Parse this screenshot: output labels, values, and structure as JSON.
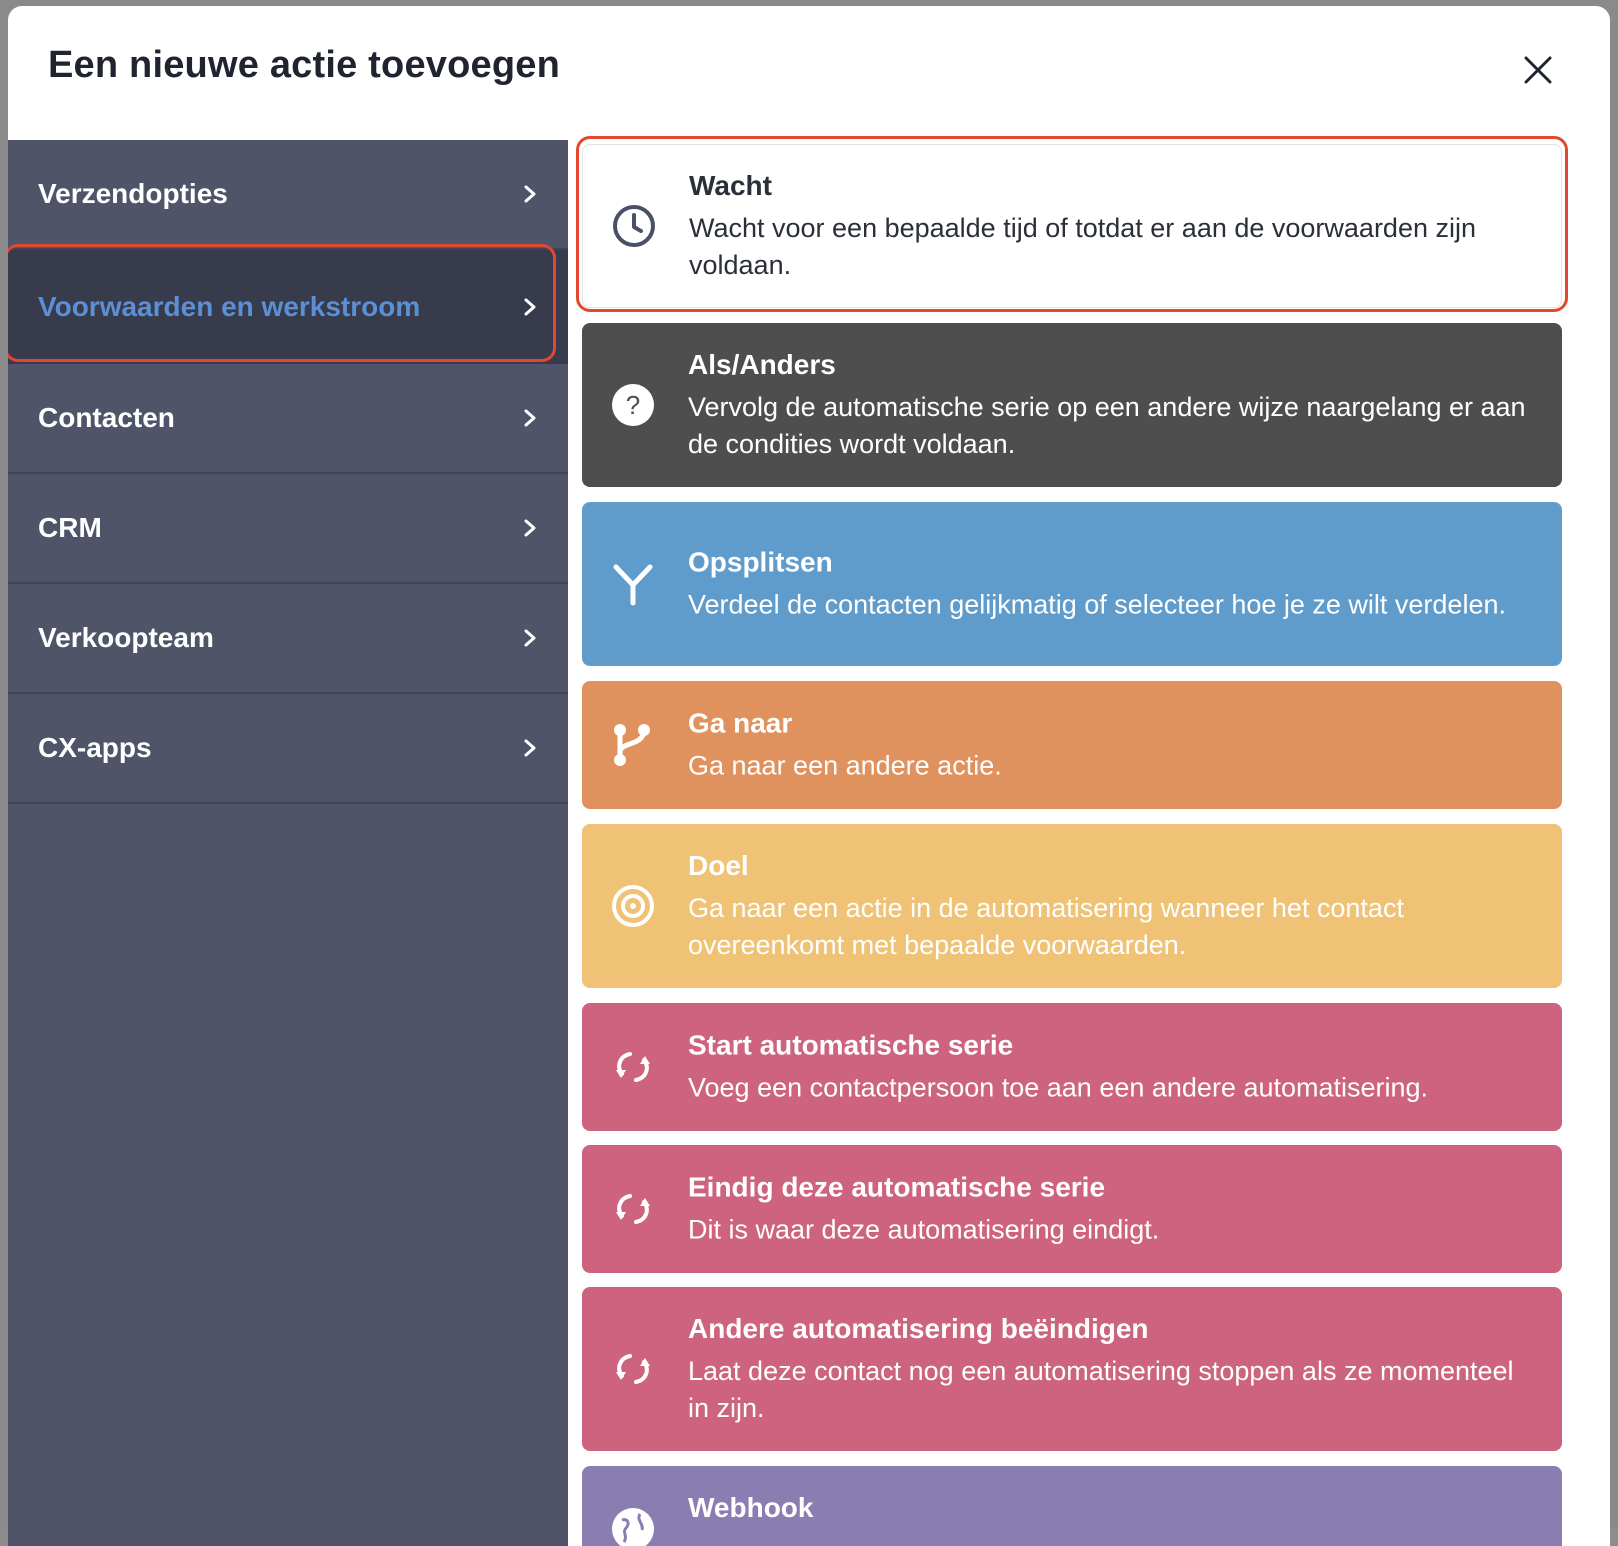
{
  "modal": {
    "title": "Een nieuwe actie toevoegen"
  },
  "sidebar": {
    "items": [
      {
        "label": "Verzendopties"
      },
      {
        "label": "Voorwaarden en werkstroom"
      },
      {
        "label": "Contacten"
      },
      {
        "label": "CRM"
      },
      {
        "label": "Verkoopteam"
      },
      {
        "label": "CX-apps"
      }
    ]
  },
  "actions": [
    {
      "title": "Wacht",
      "desc": "Wacht voor een bepaalde tijd of totdat er aan de voorwaarden zijn voldaan.",
      "icon": "clock-icon"
    },
    {
      "title": "Als/Anders",
      "desc": "Vervolg de automatische serie op een andere wijze naargelang er aan de condities wordt voldaan.",
      "icon": "question-icon"
    },
    {
      "title": "Opsplitsen",
      "desc": "Verdeel de contacten gelijkmatig of selecteer hoe je ze wilt verdelen.",
      "icon": "split-icon"
    },
    {
      "title": "Ga naar",
      "desc": "Ga naar een andere actie.",
      "icon": "branch-icon"
    },
    {
      "title": "Doel",
      "desc": "Ga naar een actie in de automatisering wanneer het contact overeenkomt met bepaalde voorwaarden.",
      "icon": "target-icon"
    },
    {
      "title": "Start automatische serie",
      "desc": "Voeg een contactpersoon toe aan een andere automatisering.",
      "icon": "sync-icon"
    },
    {
      "title": "Eindig deze automatische serie",
      "desc": "Dit is waar deze automatisering eindigt.",
      "icon": "sync-icon"
    },
    {
      "title": "Andere automatisering beëindigen",
      "desc": "Laat deze contact nog een automatisering stoppen als ze momenteel in zijn.",
      "icon": "sync-icon"
    },
    {
      "title": "Webhook",
      "desc": "",
      "icon": "globe-icon"
    }
  ],
  "colors": {
    "sidebar_bg": "#4f5468",
    "sidebar_active_bg": "#373b4b",
    "sidebar_active_text": "#5b8fd6",
    "highlight": "#e5462f",
    "card_dark": "#4e4e4e",
    "card_blue": "#5f9ccb",
    "card_orange": "#e0925e",
    "card_yellow": "#efc275",
    "card_pink": "#cd637e",
    "card_purple": "#8a7db2"
  }
}
